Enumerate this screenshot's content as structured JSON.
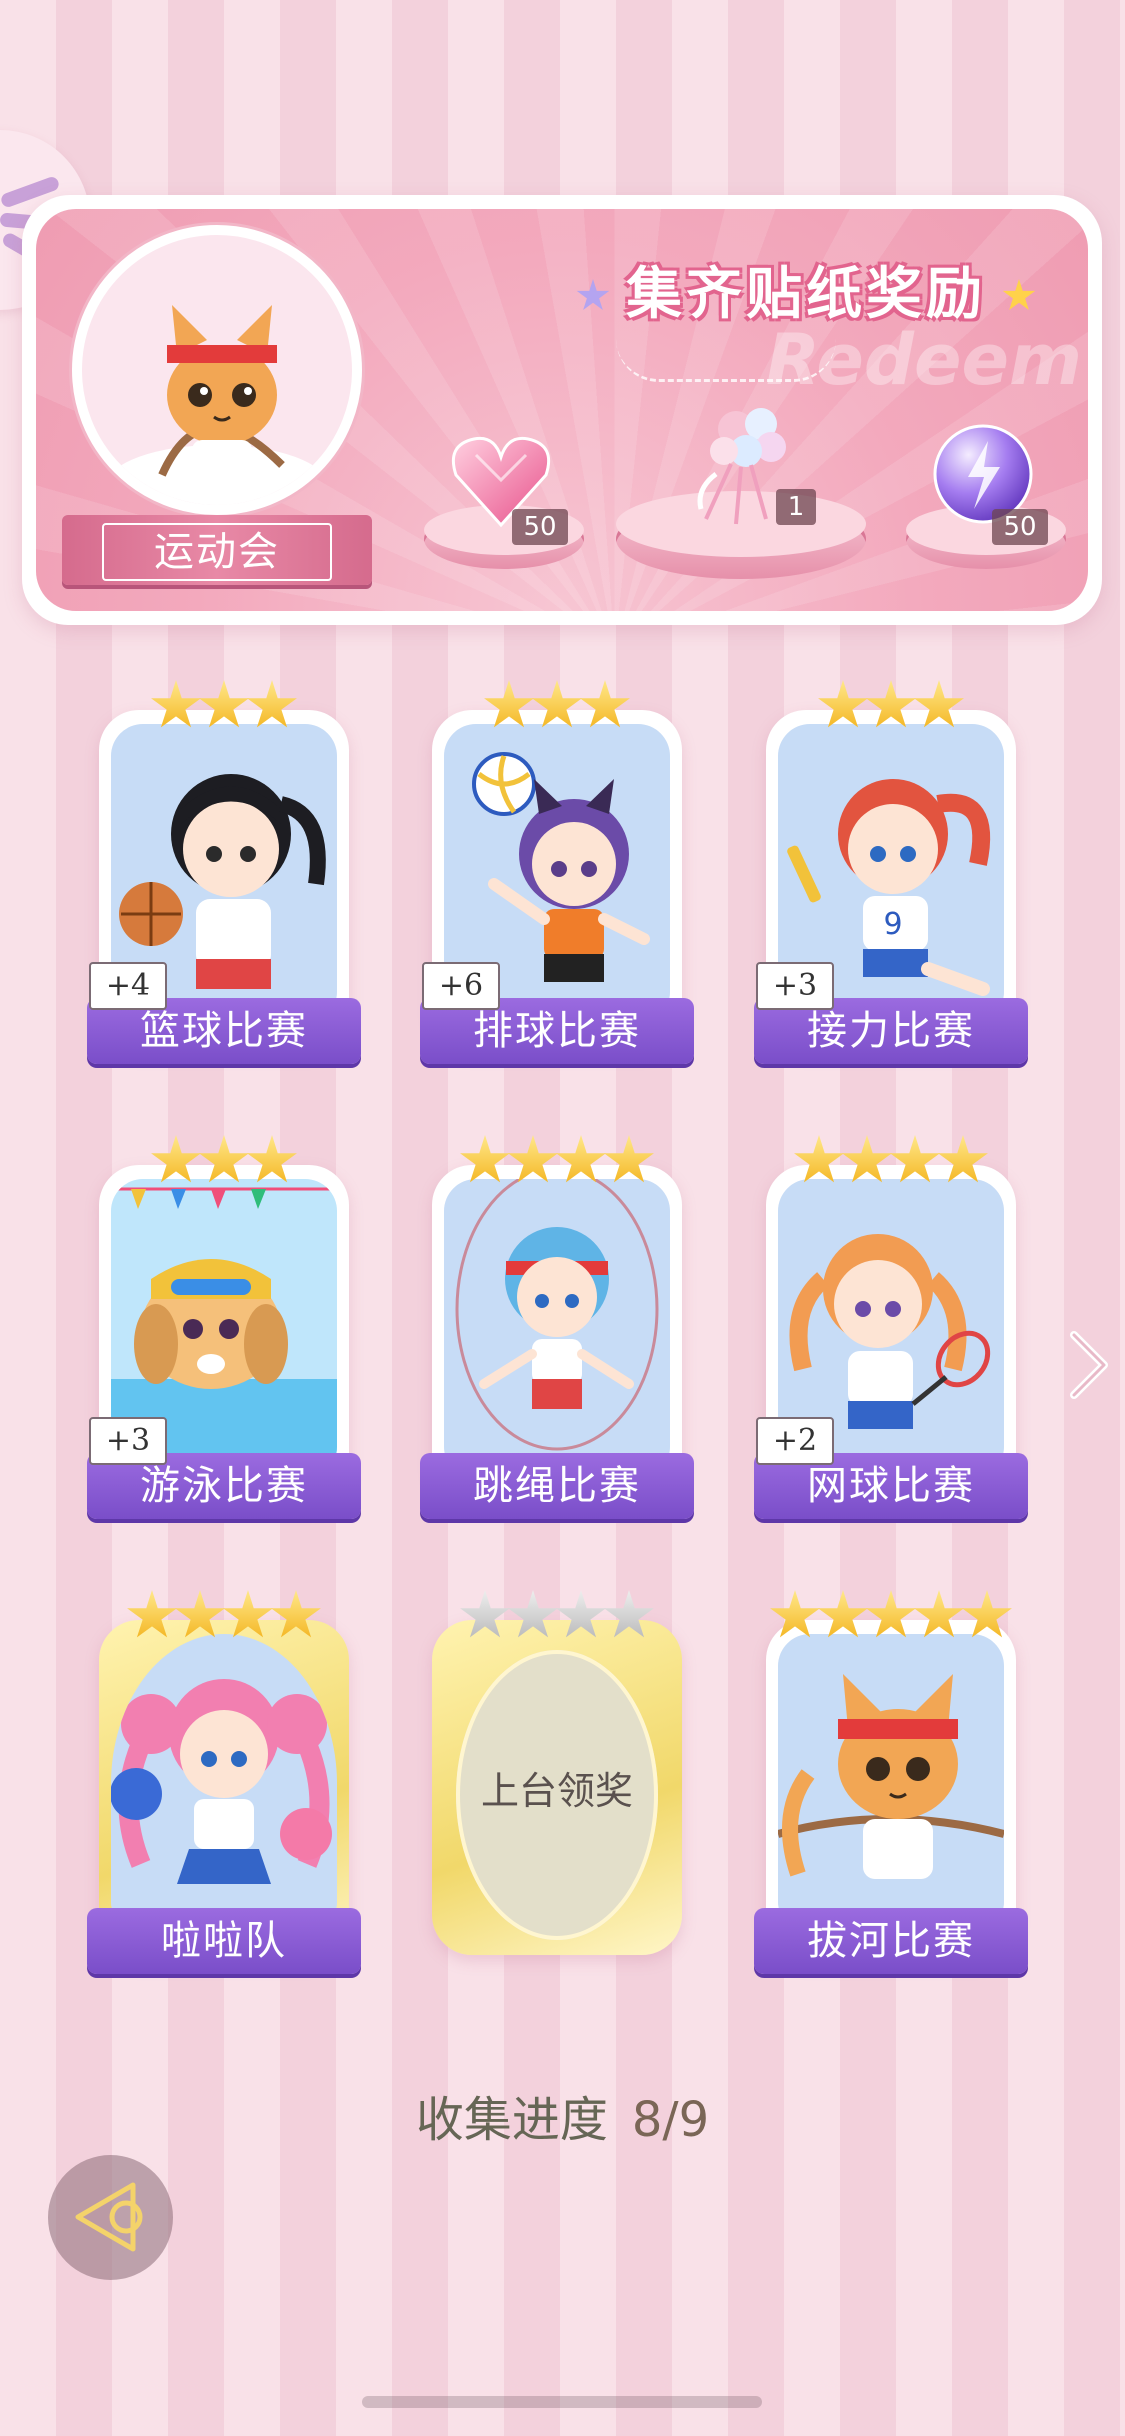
{
  "banner": {
    "title": "集齐贴纸奖励",
    "watermark": "Redeem",
    "event_name": "运动会",
    "rewards": [
      {
        "name": "pink-heart-gem-icon",
        "count": "50"
      },
      {
        "name": "flower-bouquet-icon",
        "count": "1"
      },
      {
        "name": "purple-lightning-orb-icon",
        "count": "50"
      }
    ]
  },
  "cards": [
    {
      "label": "篮球比赛",
      "stars": 3,
      "grey_stars": 0,
      "plus": "+4",
      "art": "basketball-girl",
      "state": "collected"
    },
    {
      "label": "排球比赛",
      "stars": 3,
      "grey_stars": 0,
      "plus": "+6",
      "art": "volleyball-girl",
      "state": "collected"
    },
    {
      "label": "接力比赛",
      "stars": 3,
      "grey_stars": 0,
      "plus": "+3",
      "art": "relay-girl",
      "state": "collected"
    },
    {
      "label": "游泳比赛",
      "stars": 3,
      "grey_stars": 0,
      "plus": "+3",
      "art": "swimming-dog",
      "state": "collected"
    },
    {
      "label": "跳绳比赛",
      "stars": 4,
      "grey_stars": 0,
      "plus": "",
      "art": "jumprope-girl",
      "state": "collected"
    },
    {
      "label": "网球比赛",
      "stars": 4,
      "grey_stars": 0,
      "plus": "+2",
      "art": "tennis-girl",
      "state": "collected"
    },
    {
      "label": "啦啦队",
      "stars": 4,
      "grey_stars": 0,
      "plus": "",
      "art": "cheerleader-girl",
      "state": "gold"
    },
    {
      "label": "",
      "stars": 0,
      "grey_stars": 4,
      "plus": "",
      "art": "",
      "state": "locked",
      "locked_text": "上台领奖"
    },
    {
      "label": "拔河比赛",
      "stars": 5,
      "grey_stars": 0,
      "plus": "",
      "art": "tugofwar-cat",
      "state": "collected"
    }
  ],
  "progress": {
    "label": "收集进度",
    "value": "8/9"
  },
  "colors": {
    "accent_purple": "#8a5cd6",
    "banner_pink": "#f3a9bd",
    "gold_star": "#f3b31d"
  }
}
